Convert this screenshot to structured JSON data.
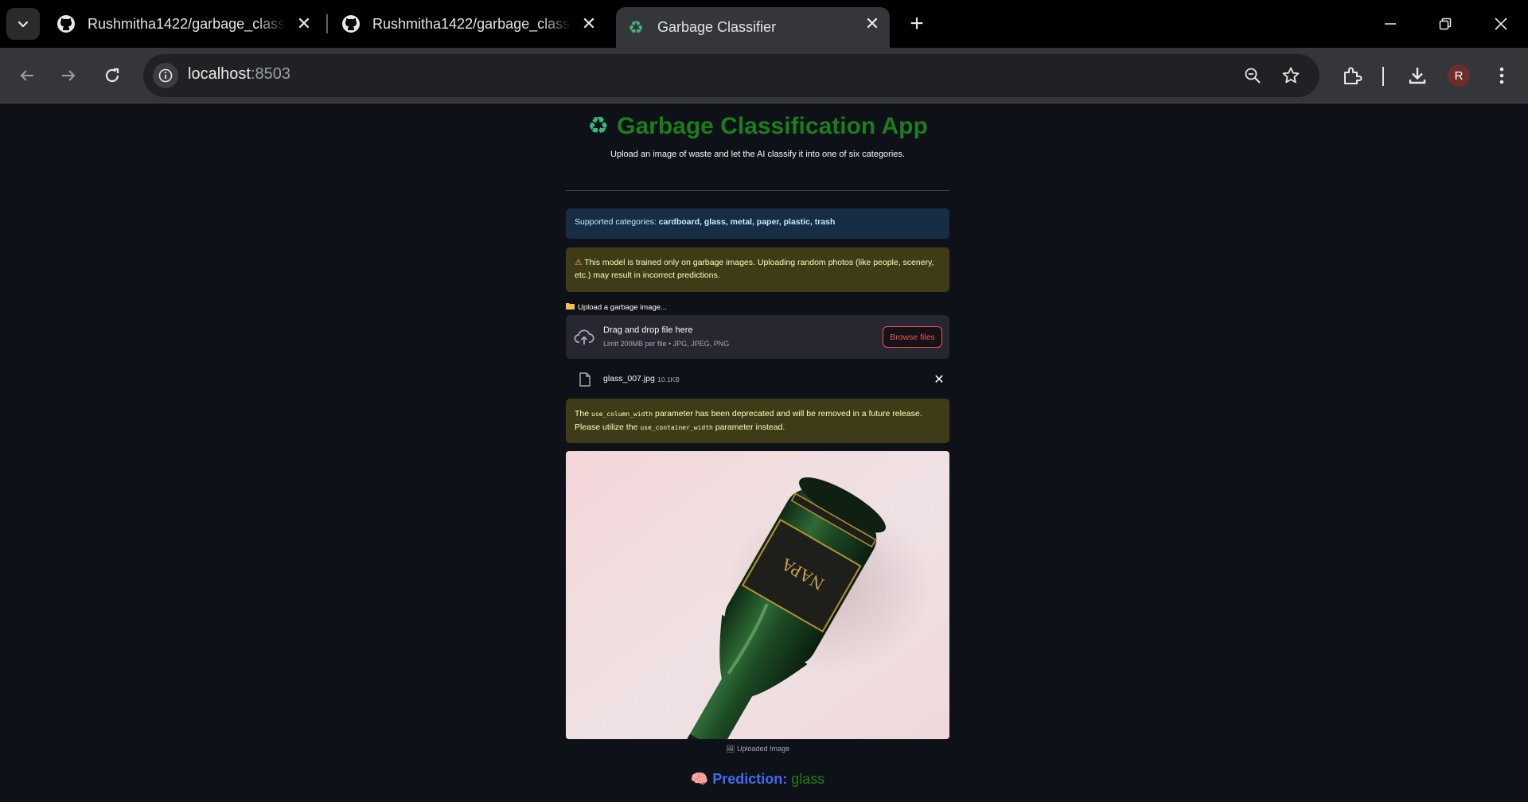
{
  "browser": {
    "tabs": [
      {
        "title": "Rushmitha1422/garbage_classifier",
        "icon": "github-icon",
        "active": false
      },
      {
        "title": "Rushmitha1422/garbage_classifier",
        "icon": "github-icon",
        "active": false
      },
      {
        "title": "Garbage Classifier",
        "icon": "recycle-icon",
        "active": true
      }
    ],
    "address": {
      "host": "localhost",
      "port": ":8503"
    }
  },
  "app": {
    "title": "Garbage Classification App",
    "title_icon": "recycle-icon",
    "subtitle": "Upload an image of waste and let the AI classify it into one of six categories.",
    "info": {
      "prefix": "Supported categories: ",
      "categories": "cardboard, glass, metal, paper, plastic, trash"
    },
    "warning": "This model is trained only on garbage images. Uploading random photos (like people, scenery, etc.) may result in incorrect predictions.",
    "uploader": {
      "label": "Upload a garbage image...",
      "drop_title": "Drag and drop file here",
      "drop_sub": "Limit 200MB per file • JPG, JPEG, PNG",
      "browse_label": "Browse files",
      "file_name": "glass_007.jpg",
      "file_size": "10.1KB"
    },
    "deprecation": {
      "t1": "The ",
      "c1": "use_column_width",
      "t2": " parameter has been deprecated and will be removed in a future release. Please utilize the ",
      "c2": "use_container_width",
      "t3": " parameter instead."
    },
    "image_caption": "Uploaded Image",
    "prediction": {
      "label": "Prediction:",
      "value": "glass"
    }
  },
  "colors": {
    "title_green": "#1a7e1a",
    "prediction_blue": "#3f6cf0",
    "browse_red": "#ff4b4b",
    "info_bg": "#172d43",
    "warning_bg": "#3e3b16"
  }
}
